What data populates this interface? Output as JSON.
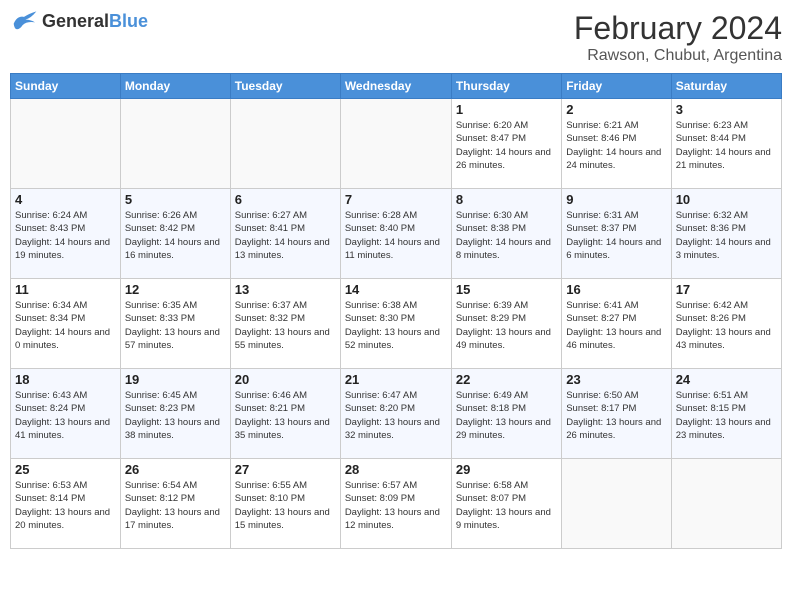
{
  "header": {
    "logo": {
      "general": "General",
      "blue": "Blue"
    },
    "title": "February 2024",
    "subtitle": "Rawson, Chubut, Argentina"
  },
  "weekdays": [
    "Sunday",
    "Monday",
    "Tuesday",
    "Wednesday",
    "Thursday",
    "Friday",
    "Saturday"
  ],
  "weeks": [
    [
      {
        "day": "",
        "info": ""
      },
      {
        "day": "",
        "info": ""
      },
      {
        "day": "",
        "info": ""
      },
      {
        "day": "",
        "info": ""
      },
      {
        "day": "1",
        "info": "Sunrise: 6:20 AM\nSunset: 8:47 PM\nDaylight: 14 hours and 26 minutes."
      },
      {
        "day": "2",
        "info": "Sunrise: 6:21 AM\nSunset: 8:46 PM\nDaylight: 14 hours and 24 minutes."
      },
      {
        "day": "3",
        "info": "Sunrise: 6:23 AM\nSunset: 8:44 PM\nDaylight: 14 hours and 21 minutes."
      }
    ],
    [
      {
        "day": "4",
        "info": "Sunrise: 6:24 AM\nSunset: 8:43 PM\nDaylight: 14 hours and 19 minutes."
      },
      {
        "day": "5",
        "info": "Sunrise: 6:26 AM\nSunset: 8:42 PM\nDaylight: 14 hours and 16 minutes."
      },
      {
        "day": "6",
        "info": "Sunrise: 6:27 AM\nSunset: 8:41 PM\nDaylight: 14 hours and 13 minutes."
      },
      {
        "day": "7",
        "info": "Sunrise: 6:28 AM\nSunset: 8:40 PM\nDaylight: 14 hours and 11 minutes."
      },
      {
        "day": "8",
        "info": "Sunrise: 6:30 AM\nSunset: 8:38 PM\nDaylight: 14 hours and 8 minutes."
      },
      {
        "day": "9",
        "info": "Sunrise: 6:31 AM\nSunset: 8:37 PM\nDaylight: 14 hours and 6 minutes."
      },
      {
        "day": "10",
        "info": "Sunrise: 6:32 AM\nSunset: 8:36 PM\nDaylight: 14 hours and 3 minutes."
      }
    ],
    [
      {
        "day": "11",
        "info": "Sunrise: 6:34 AM\nSunset: 8:34 PM\nDaylight: 14 hours and 0 minutes."
      },
      {
        "day": "12",
        "info": "Sunrise: 6:35 AM\nSunset: 8:33 PM\nDaylight: 13 hours and 57 minutes."
      },
      {
        "day": "13",
        "info": "Sunrise: 6:37 AM\nSunset: 8:32 PM\nDaylight: 13 hours and 55 minutes."
      },
      {
        "day": "14",
        "info": "Sunrise: 6:38 AM\nSunset: 8:30 PM\nDaylight: 13 hours and 52 minutes."
      },
      {
        "day": "15",
        "info": "Sunrise: 6:39 AM\nSunset: 8:29 PM\nDaylight: 13 hours and 49 minutes."
      },
      {
        "day": "16",
        "info": "Sunrise: 6:41 AM\nSunset: 8:27 PM\nDaylight: 13 hours and 46 minutes."
      },
      {
        "day": "17",
        "info": "Sunrise: 6:42 AM\nSunset: 8:26 PM\nDaylight: 13 hours and 43 minutes."
      }
    ],
    [
      {
        "day": "18",
        "info": "Sunrise: 6:43 AM\nSunset: 8:24 PM\nDaylight: 13 hours and 41 minutes."
      },
      {
        "day": "19",
        "info": "Sunrise: 6:45 AM\nSunset: 8:23 PM\nDaylight: 13 hours and 38 minutes."
      },
      {
        "day": "20",
        "info": "Sunrise: 6:46 AM\nSunset: 8:21 PM\nDaylight: 13 hours and 35 minutes."
      },
      {
        "day": "21",
        "info": "Sunrise: 6:47 AM\nSunset: 8:20 PM\nDaylight: 13 hours and 32 minutes."
      },
      {
        "day": "22",
        "info": "Sunrise: 6:49 AM\nSunset: 8:18 PM\nDaylight: 13 hours and 29 minutes."
      },
      {
        "day": "23",
        "info": "Sunrise: 6:50 AM\nSunset: 8:17 PM\nDaylight: 13 hours and 26 minutes."
      },
      {
        "day": "24",
        "info": "Sunrise: 6:51 AM\nSunset: 8:15 PM\nDaylight: 13 hours and 23 minutes."
      }
    ],
    [
      {
        "day": "25",
        "info": "Sunrise: 6:53 AM\nSunset: 8:14 PM\nDaylight: 13 hours and 20 minutes."
      },
      {
        "day": "26",
        "info": "Sunrise: 6:54 AM\nSunset: 8:12 PM\nDaylight: 13 hours and 17 minutes."
      },
      {
        "day": "27",
        "info": "Sunrise: 6:55 AM\nSunset: 8:10 PM\nDaylight: 13 hours and 15 minutes."
      },
      {
        "day": "28",
        "info": "Sunrise: 6:57 AM\nSunset: 8:09 PM\nDaylight: 13 hours and 12 minutes."
      },
      {
        "day": "29",
        "info": "Sunrise: 6:58 AM\nSunset: 8:07 PM\nDaylight: 13 hours and 9 minutes."
      },
      {
        "day": "",
        "info": ""
      },
      {
        "day": "",
        "info": ""
      }
    ]
  ]
}
